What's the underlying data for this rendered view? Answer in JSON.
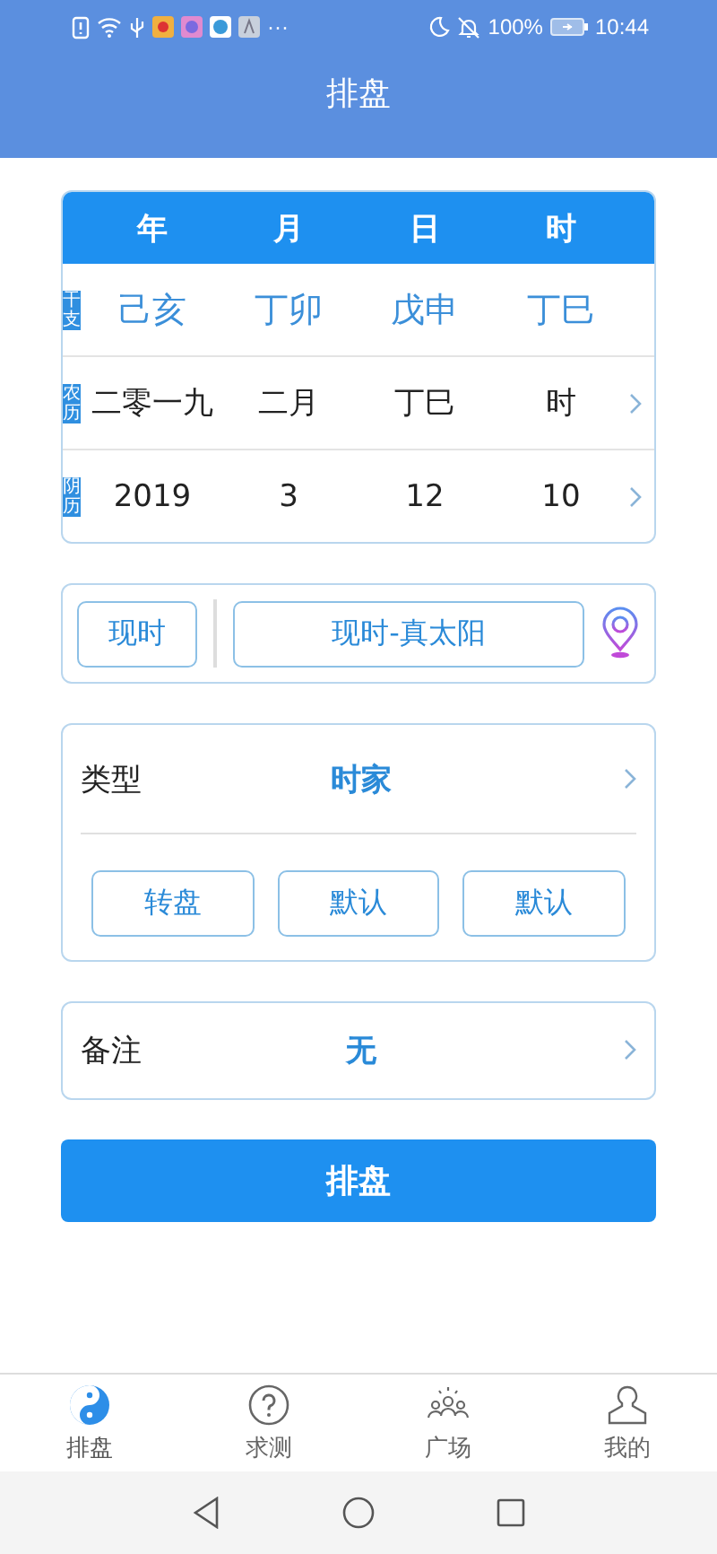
{
  "status_bar": {
    "more": "···",
    "battery": "100%",
    "time": "10:44"
  },
  "title": "排盘",
  "date_table": {
    "columns": [
      "年",
      "月",
      "日",
      "时"
    ],
    "rows": [
      {
        "label": "干支",
        "kind": "ganzhi",
        "chevron": false,
        "cells": [
          "己亥",
          "丁卯",
          "戊申",
          "丁巳"
        ]
      },
      {
        "label": "农历",
        "kind": "plain",
        "chevron": true,
        "cells": [
          "二零一九",
          "二月",
          "丁巳",
          "时"
        ]
      },
      {
        "label": "阴历",
        "kind": "plain",
        "chevron": true,
        "cells": [
          "2019",
          "3",
          "12",
          "10"
        ]
      }
    ]
  },
  "time_buttons": [
    "现时",
    "现时-真太阳"
  ],
  "type_row": {
    "label": "类型",
    "value": "时家"
  },
  "type_buttons": [
    "转盘",
    "默认",
    "默认"
  ],
  "note_row": {
    "label": "备注",
    "value": "无"
  },
  "submit": "排盘",
  "tabs": [
    {
      "label": "排盘",
      "selected": true
    },
    {
      "label": "求测",
      "selected": false
    },
    {
      "label": "广场",
      "selected": false
    },
    {
      "label": "我的",
      "selected": false
    }
  ]
}
